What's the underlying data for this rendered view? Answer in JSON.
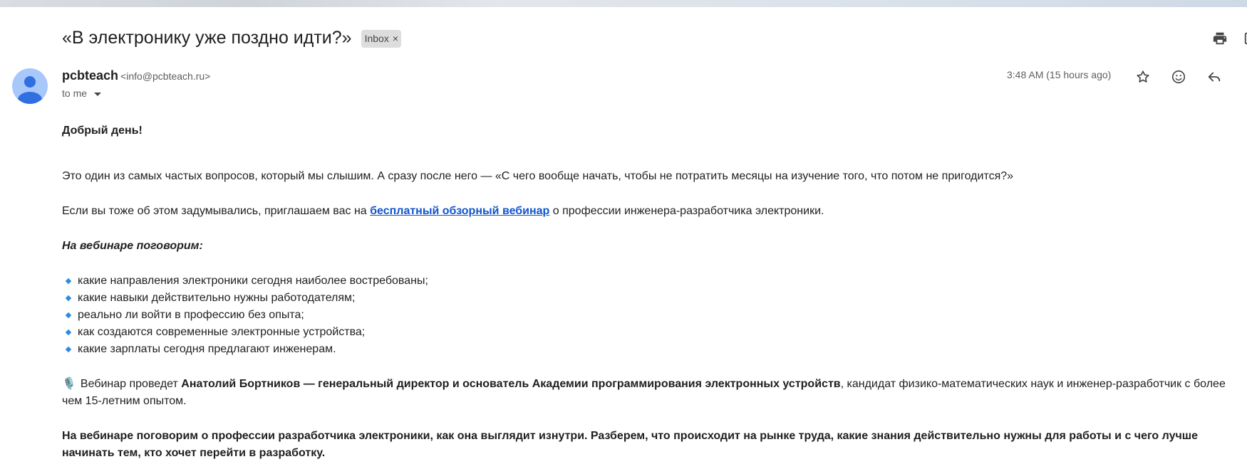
{
  "email": {
    "subject": "«В электронику уже поздно идти?»",
    "label": "Inbox",
    "label_remove": "×",
    "sender_name": "pcbteach",
    "sender_email": "<info@pcbteach.ru>",
    "recipient": "to me",
    "time": "3:48 AM (15 hours ago)"
  },
  "icons": {
    "print": "print-icon",
    "open_new_window": "open-in-new-window-icon",
    "star": "star-icon",
    "emoji": "emoji-icon",
    "reply": "reply-icon",
    "avatar": "person-icon",
    "dropdown": "chevron-down-icon",
    "bullet": "blue-diamond-icon",
    "mic": "microphone-icon"
  },
  "body": {
    "greeting": "Добрый день!",
    "p1": "Это один из самых частых вопросов, который мы слышим. А сразу после него — «С чего вообще начать, чтобы не потратить месяцы на изучение того, что потом не пригодится?»",
    "p2_before": "Если вы тоже об этом задумывались, приглашаем вас на ",
    "p2_link": "бесплатный обзорный вебинар",
    "p2_after": " о профессии инженера-разработчика электроники.",
    "webinar_heading": "На вебинаре поговорим:",
    "bullets": [
      "какие направления электроники сегодня наиболее востребованы;",
      "какие навыки действительно нужны работодателям;",
      "реально ли войти в профессию без опыта;",
      "как создаются современные электронные устройства;",
      "какие зарплаты сегодня предлагают инженерам."
    ],
    "host_mic": "🎙️",
    "host_before": "Вебинар проведет ",
    "host_bold": "Анатолий Бортников — генеральный директор и основатель Академии программирования электронных устройств",
    "host_after": ", кандидат физико-математических наук и инженер-разработчик с более чем 15-летним опытом.",
    "final": "На вебинаре поговорим о профессии разработчика электроники, как она выглядит изнутри. Разберем, что происходит на рынке труда, какие знания действительно нужны для работы и с чего лучше начинать тем, кто хочет перейти в разработку."
  },
  "colors": {
    "link": "#1155cc",
    "bullet": "#2a8be0",
    "avatar_bg": "#a8c7fa",
    "avatar_fg": "#2f6fe0"
  }
}
